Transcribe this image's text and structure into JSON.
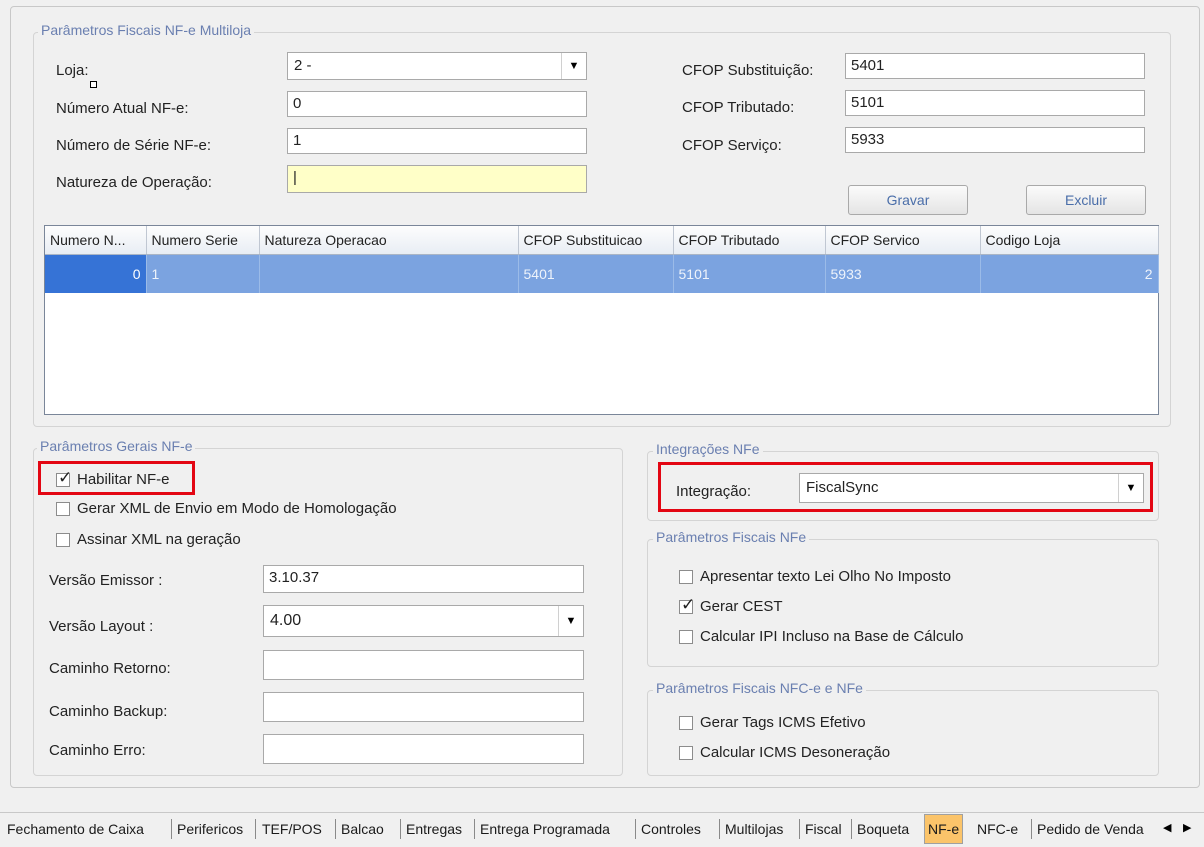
{
  "multiloja": {
    "legend": "Parâmetros Fiscais NF-e Multiloja",
    "loja_label": "Loja:",
    "loja_value": "2 -",
    "numero_atual_label": "Número Atual NF-e:",
    "numero_atual_value": "0",
    "numero_serie_label": "Número de Série NF-e:",
    "numero_serie_value": "1",
    "natureza_label": "Natureza de Operação:",
    "natureza_value": "|",
    "cfop_subst_label": "CFOP Substituição:",
    "cfop_subst_value": "5401",
    "cfop_trib_label": "CFOP Tributado:",
    "cfop_trib_value": "5101",
    "cfop_serv_label": "CFOP Serviço:",
    "cfop_serv_value": "5933",
    "gravar": "Gravar",
    "excluir": "Excluir",
    "columns": [
      "Numero N...",
      "Numero Serie",
      "Natureza Operacao",
      "CFOP Substituicao",
      "CFOP Tributado",
      "CFOP Servico",
      "Codigo Loja"
    ],
    "rows": [
      [
        "0",
        "1",
        "",
        "5401",
        "5101",
        "5933",
        "2"
      ]
    ]
  },
  "gerais": {
    "legend": "Parâmetros Gerais NF-e",
    "habilitar": "Habilitar NF-e",
    "habilitar_checked": true,
    "homologacao": "Gerar XML de Envio em Modo de Homologação",
    "assinar": "Assinar XML na geração",
    "versao_emissor_label": "Versão Emissor :",
    "versao_emissor_value": "3.10.37",
    "versao_layout_label": "Versão Layout :",
    "versao_layout_value": "4.00",
    "caminho_retorno_label": "Caminho Retorno:",
    "caminho_backup_label": "Caminho Backup:",
    "caminho_erro_label": "Caminho Erro:"
  },
  "integracoes": {
    "legend": "Integrações NFe",
    "label": "Integração:",
    "value": "FiscalSync"
  },
  "fiscais_nfe": {
    "legend": "Parâmetros Fiscais NFe",
    "lei_olho": "Apresentar texto Lei Olho No Imposto",
    "gerar_cest": "Gerar CEST",
    "gerar_cest_checked": true,
    "calcular_ipi": "Calcular IPI Incluso na Base de Cálculo"
  },
  "fiscais_nfce": {
    "legend": "Parâmetros Fiscais NFC-e e NFe",
    "tags_icms": "Gerar Tags ICMS Efetivo",
    "icms_desoneracao": "Calcular ICMS Desoneração"
  },
  "tabs": [
    "Fechamento de Caixa",
    "Perifericos",
    "TEF/POS",
    "Balcao",
    "Entregas",
    "Entrega Programada",
    "Controles",
    "Multilojas",
    "Fiscal",
    "Boqueta",
    "NF-e",
    "NFC-e",
    "Pedido de Venda"
  ],
  "active_tab": "NF-e",
  "colors": {
    "highlight": "#e30613",
    "selected_row": "#7ba3e0",
    "input_focus": "#ffffc8",
    "active_tab": "#fbc46a"
  }
}
